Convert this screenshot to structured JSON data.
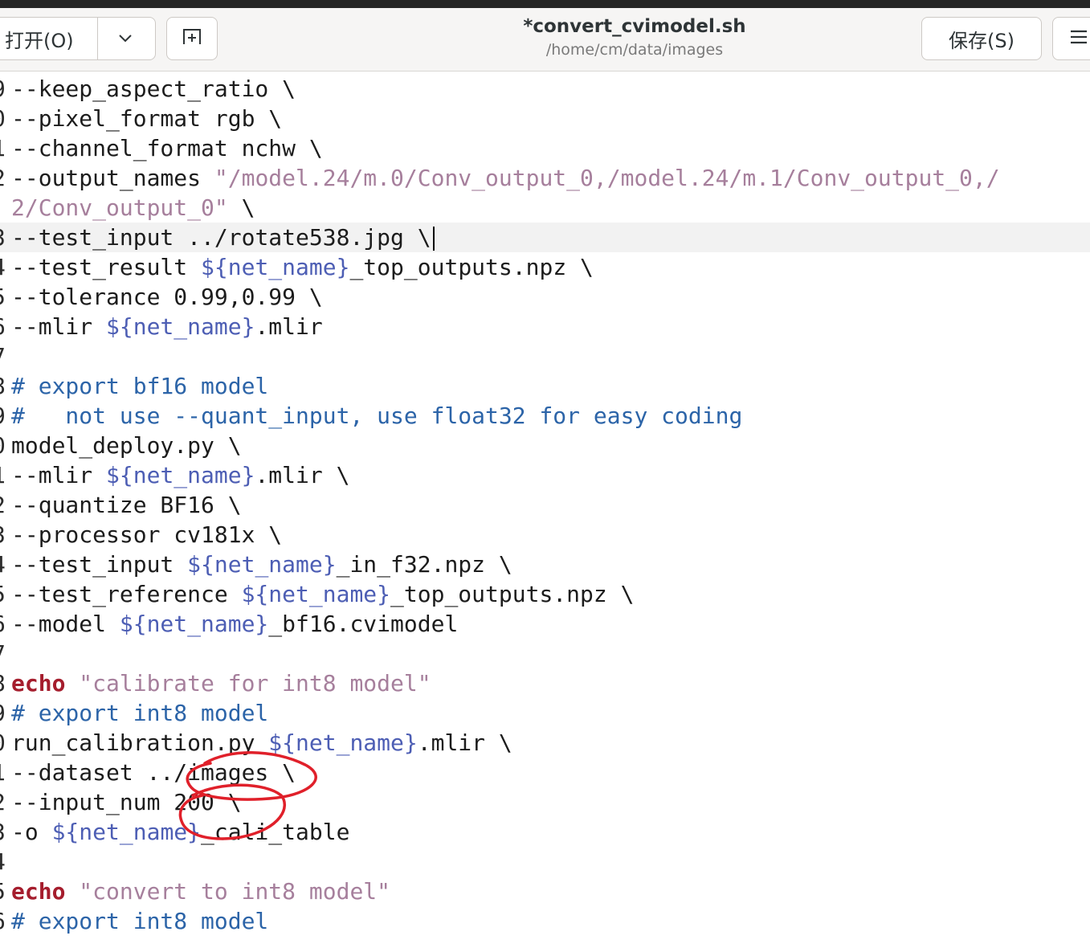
{
  "header": {
    "open_label": "打开(O)",
    "open_menu_icon": "chevron-down-icon",
    "new_tab_icon": "new-tab-icon",
    "title": "*convert_cvimodel.sh",
    "subtitle": "/home/cm/data/images",
    "save_label": "保存(S)",
    "menu_icon": "hamburger-menu-icon"
  },
  "editor": {
    "gutter": [
      "9",
      "0",
      "1",
      "2",
      "",
      "3",
      "4",
      "5",
      "6",
      "7",
      "8",
      "9",
      "0",
      "1",
      "2",
      "3",
      "4",
      "5",
      "6",
      "7",
      "8",
      "9",
      "0",
      "1",
      "2",
      "3",
      "4",
      "5",
      "6"
    ],
    "current_line_index": 5,
    "lines": {
      "l0_a": "--keep_aspect_ratio \\",
      "l1_a": "--pixel_format rgb \\",
      "l2_a": "--channel_format nchw \\",
      "l3_a": "--output_names ",
      "l3_s": "\"/model.24/m.0/Conv_output_0,/model.24/m.1/Conv_output_0,/",
      "l4_s": "2/Conv_output_0\"",
      "l4_b": " \\",
      "l5_a": "--test_input ",
      "l5_b": "../rotate538.jpg \\",
      "l6_a": "--test_result ",
      "l6_v": "${net_name}",
      "l6_b": "_top_outputs.npz \\",
      "l7_a": "--tolerance 0.99,0.99 \\",
      "l8_a": "--mlir ",
      "l8_v": "${net_name}",
      "l8_b": ".mlir",
      "l10_c": "# export bf16 model",
      "l11_c": "#   not use --quant_input, use float32 for easy coding",
      "l12_a": "model_deploy.py \\",
      "l13_a": "--mlir ",
      "l13_v": "${net_name}",
      "l13_b": ".mlir \\",
      "l14_a": "--quantize BF16 \\",
      "l15_a": "--processor cv181x \\",
      "l16_a": "--test_input ",
      "l16_v": "${net_name}",
      "l16_b": "_in_f32.npz \\",
      "l17_a": "--test_reference ",
      "l17_v": "${net_name}",
      "l17_b": "_top_outputs.npz \\",
      "l18_a": "--model ",
      "l18_v": "${net_name}",
      "l18_b": "_bf16.cvimodel",
      "l20_k": "echo",
      "l20_s": " \"calibrate for int8 model\"",
      "l21_c": "# export int8 model",
      "l22_a": "run_calibration.py ",
      "l22_v": "${net_name}",
      "l22_b": ".mlir \\",
      "l23_a": "--dataset ../images \\",
      "l24_a": "--input_num 200 \\",
      "l25_a": "-o ",
      "l25_v": "${net_name}",
      "l25_b": "_cali_table",
      "l27_k": "echo",
      "l27_s": " \"convert to int8 model\"",
      "l28_c": "# export int8 model"
    }
  },
  "annotation": {
    "color": "#e0202a"
  }
}
